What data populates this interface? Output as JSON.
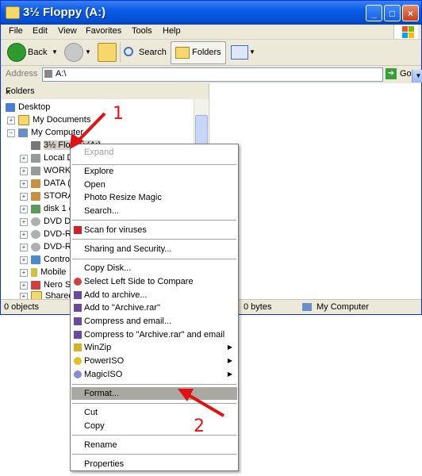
{
  "window": {
    "title": "3½ Floppy (A:)",
    "title_buttons": [
      "_",
      "□",
      "×"
    ]
  },
  "menubar": {
    "items": [
      "File",
      "Edit",
      "View",
      "Favorites",
      "Tools",
      "Help"
    ]
  },
  "toolbar": {
    "back_label": "Back",
    "search_label": "Search",
    "folders_label": "Folders",
    "icons": [
      "back-arrow-icon",
      "forward-arrow-icon",
      "up-folder-icon",
      "search-icon",
      "folders-icon",
      "views-icon"
    ]
  },
  "address": {
    "label": "Address",
    "value": "A:\\",
    "go_label": "Go"
  },
  "folders_pane": {
    "title": "Folders",
    "close": "×",
    "tree": [
      {
        "label": "Desktop",
        "icon": "desktop-icon"
      },
      {
        "label": "My Documents",
        "icon": "documents-icon"
      },
      {
        "label": "My Computer",
        "icon": "computer-icon"
      },
      {
        "label": "3½ Floppy (A:)",
        "icon": "floppy-icon"
      },
      {
        "label": "Local D",
        "icon": "drive-icon"
      },
      {
        "label": "WORK",
        "icon": "drive-icon"
      },
      {
        "label": "DATA (",
        "icon": "drive-icon"
      },
      {
        "label": "STORA",
        "icon": "drive-icon"
      },
      {
        "label": "disk 1 c",
        "icon": "drive-icon"
      },
      {
        "label": "DVD Dr",
        "icon": "dvd-icon"
      },
      {
        "label": "DVD-RA",
        "icon": "dvd-icon"
      },
      {
        "label": "DVD-RW",
        "icon": "dvd-icon"
      },
      {
        "label": "Control",
        "icon": "control-panel-icon"
      },
      {
        "label": "Mobile",
        "icon": "mobile-icon"
      },
      {
        "label": "Nero Sc",
        "icon": "nero-icon"
      },
      {
        "label": "Shared",
        "icon": "shared-folder-icon"
      }
    ]
  },
  "statusbar": {
    "objects": "0 objects",
    "bytes": "0 bytes",
    "location": "My Computer"
  },
  "context_menu": {
    "items": [
      {
        "label": "Expand",
        "disabled": true
      },
      {
        "label": "Explore"
      },
      {
        "label": "Open"
      },
      {
        "label": "Photo Resize Magic"
      },
      {
        "label": "Search..."
      },
      {
        "label": "Scan for viruses",
        "icon": "antivirus-icon"
      },
      {
        "label": "Sharing and Security..."
      },
      {
        "label": "Copy Disk..."
      },
      {
        "label": "Select Left Side to Compare",
        "icon": "compare-icon"
      },
      {
        "label": "Add to archive...",
        "icon": "winrar-icon"
      },
      {
        "label": "Add to \"Archive.rar\"",
        "icon": "winrar-icon"
      },
      {
        "label": "Compress and email...",
        "icon": "winrar-icon"
      },
      {
        "label": "Compress to \"Archive.rar\" and email",
        "icon": "winrar-icon"
      },
      {
        "label": "WinZip",
        "icon": "winzip-icon",
        "submenu": true
      },
      {
        "label": "PowerISO",
        "icon": "poweriso-icon",
        "submenu": true
      },
      {
        "label": "MagicISO",
        "icon": "magiciso-icon",
        "submenu": true
      },
      {
        "label": "Format...",
        "highlighted": true
      },
      {
        "label": "Cut"
      },
      {
        "label": "Copy"
      },
      {
        "label": "Rename"
      },
      {
        "label": "Properties"
      }
    ]
  },
  "annotations": {
    "step1": "1",
    "step2": "2",
    "color": "#e11111"
  }
}
